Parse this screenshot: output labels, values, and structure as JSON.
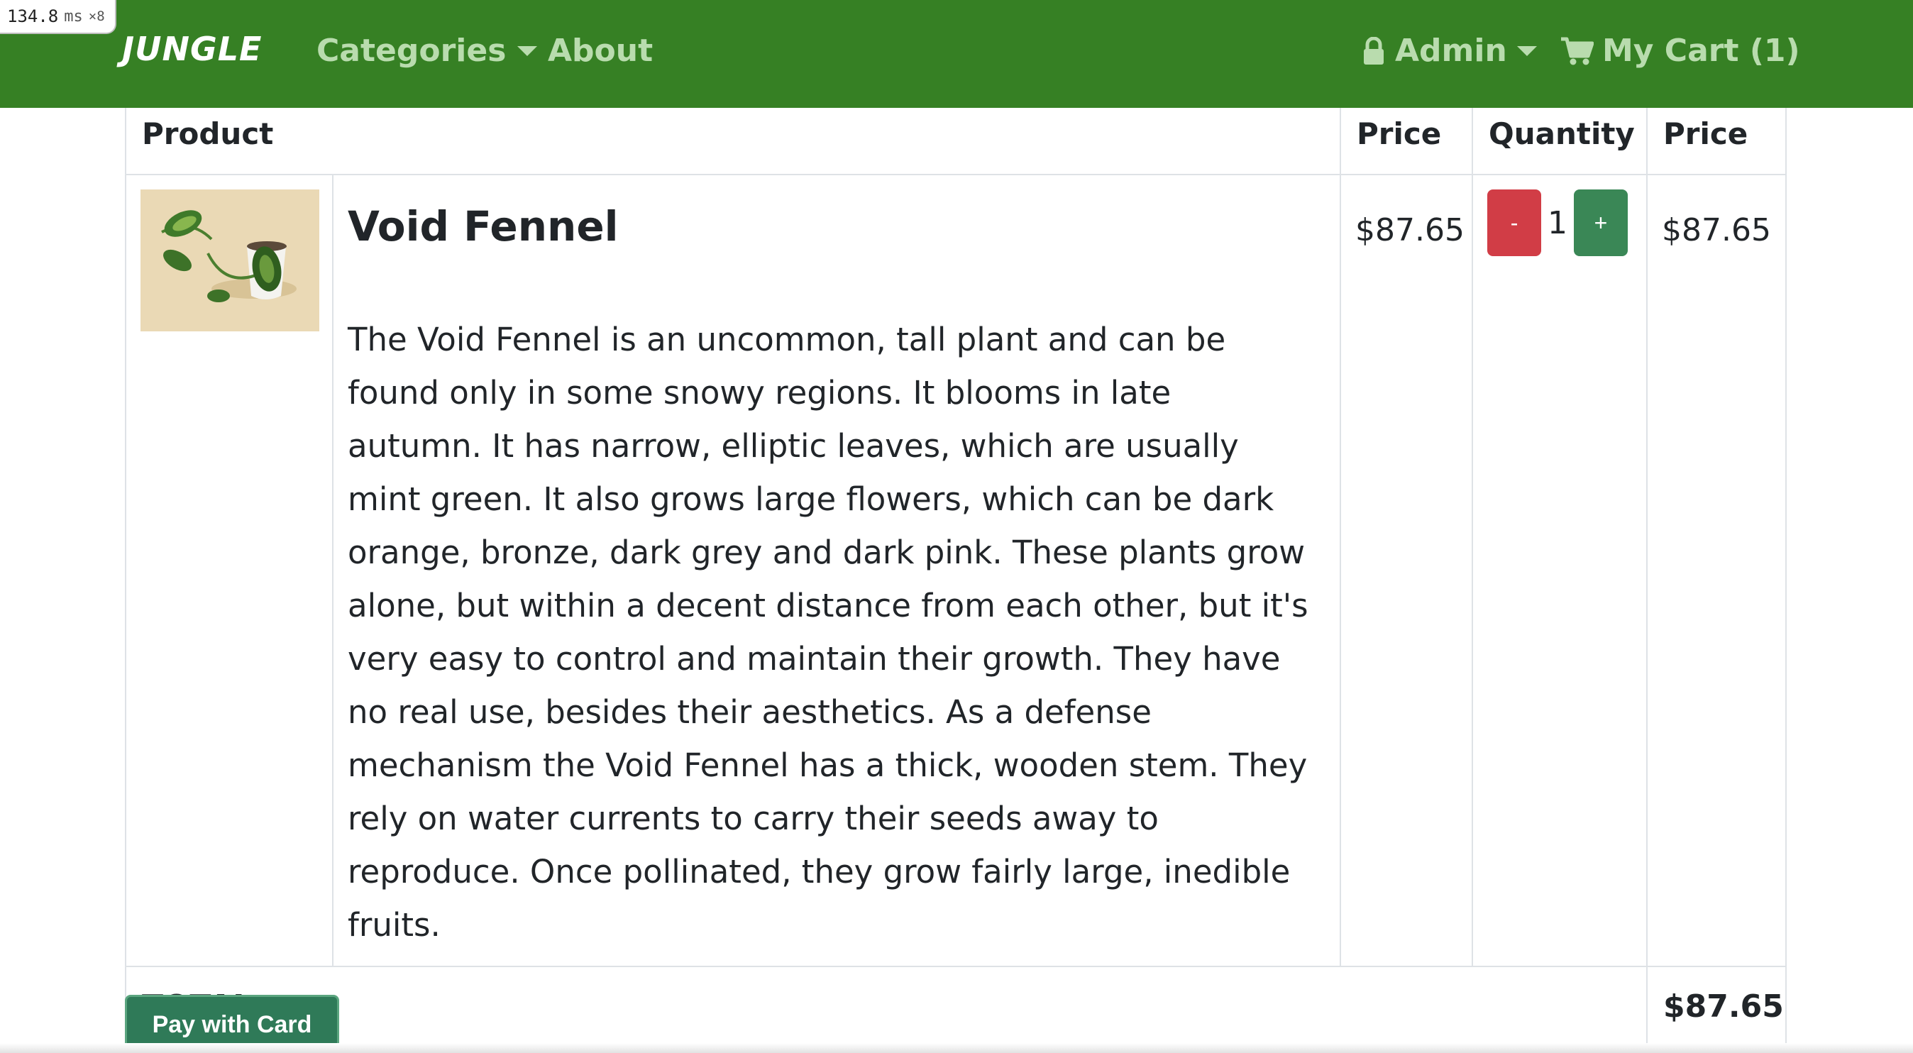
{
  "timing": {
    "value": "134.8",
    "unit": "ms",
    "multiplier": "×8"
  },
  "navbar": {
    "brand": "JUNGLE",
    "categories_label": "Categories",
    "about_label": "About",
    "admin_label": "Admin",
    "cart_label": "My Cart (1)",
    "background_color": "#368024",
    "link_color": "#b9dcae"
  },
  "table": {
    "headers": {
      "product": "Product",
      "price": "Price",
      "quantity": "Quantity",
      "line_total": "Price"
    },
    "items": [
      {
        "name": "Void Fennel",
        "description": "The Void Fennel is an uncommon, tall plant and can be found only in some snowy regions. It blooms in late autumn. It has narrow, elliptic leaves, which are usually mint green. It also grows large flowers, which can be dark orange, bronze, dark grey and dark pink. These plants grow alone, but within a decent distance from each other, but it's very easy to control and maintain their growth. They have no real use, besides their aesthetics. As a defense mechanism the Void Fennel has a thick, wooden stem. They rely on water currents to carry their seeds away to reproduce. Once pollinated, they grow fairly large, inedible fruits.",
        "price": "$87.65",
        "quantity": "1",
        "decrement_label": "-",
        "increment_label": "+",
        "line_total": "$87.65"
      }
    ],
    "total_label": "TOTAL:",
    "total_value": "$87.65"
  },
  "checkout": {
    "pay_label": "Pay with Card"
  },
  "colors": {
    "decrement": "#d13d46",
    "increment": "#3a8756",
    "pay_button": "#2f7a58"
  }
}
